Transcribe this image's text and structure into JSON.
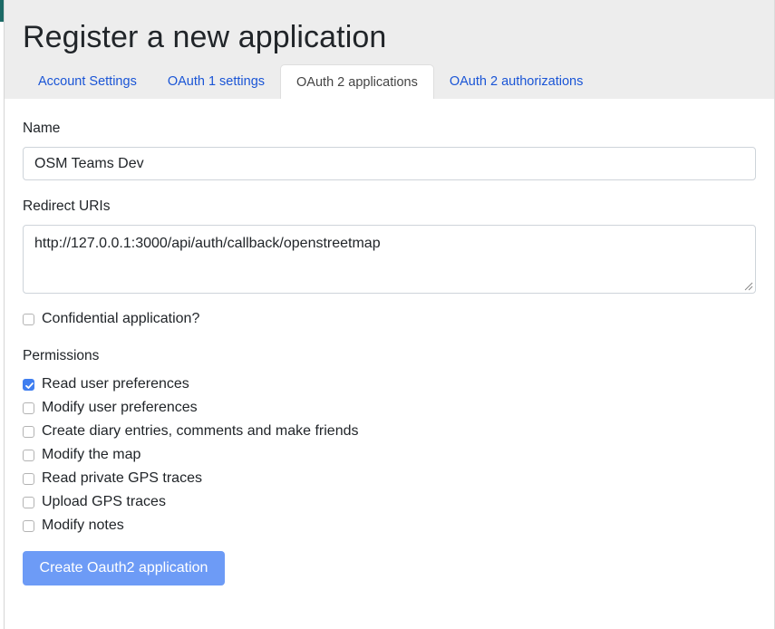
{
  "page": {
    "title": "Register a new application"
  },
  "tabs": [
    {
      "label": "Account Settings",
      "active": false
    },
    {
      "label": "OAuth 1 settings",
      "active": false
    },
    {
      "label": "OAuth 2 applications",
      "active": true
    },
    {
      "label": "OAuth 2 authorizations",
      "active": false
    }
  ],
  "form": {
    "name_label": "Name",
    "name_value": "OSM Teams Dev",
    "redirect_label": "Redirect URIs",
    "redirect_value": "http://127.0.0.1:3000/api/auth/callback/openstreetmap",
    "confidential_label": "Confidential application?",
    "confidential_checked": false,
    "permissions_label": "Permissions",
    "permissions": [
      {
        "label": "Read user preferences",
        "checked": true
      },
      {
        "label": "Modify user preferences",
        "checked": false
      },
      {
        "label": "Create diary entries, comments and make friends",
        "checked": false
      },
      {
        "label": "Modify the map",
        "checked": false
      },
      {
        "label": "Read private GPS traces",
        "checked": false
      },
      {
        "label": "Upload GPS traces",
        "checked": false
      },
      {
        "label": "Modify notes",
        "checked": false
      }
    ],
    "submit_label": "Create Oauth2 application"
  },
  "colors": {
    "accent": "#6d9bf6",
    "link": "#1a55d6",
    "header_bg": "#ededed",
    "checkbox_checked": "#3f7ef0"
  },
  "icons": {
    "checked": "checkmark-icon",
    "resize": "resize-grip-icon"
  }
}
